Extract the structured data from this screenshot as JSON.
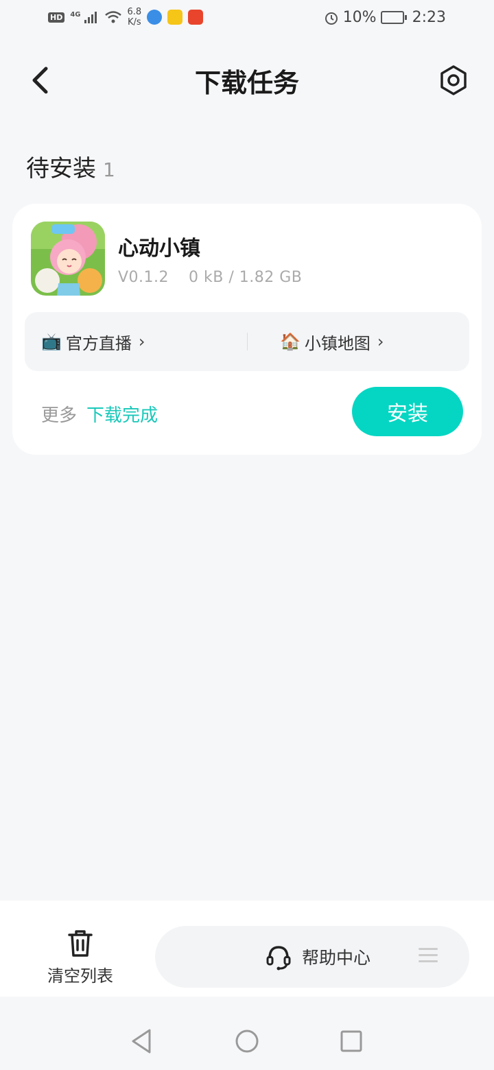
{
  "status_bar": {
    "hd": "HD",
    "network": "4G",
    "speed_value": "6.8",
    "speed_unit": "K/s",
    "battery": "10%",
    "time": "2:23"
  },
  "header": {
    "title": "下载任务",
    "back_icon": "back-arrow-icon",
    "settings_icon": "settings-icon"
  },
  "section": {
    "label": "待安装",
    "count": "1"
  },
  "task": {
    "app_name": "心动小镇",
    "version": "V0.1.2",
    "size": "0 kB / 1.82 GB",
    "links": [
      {
        "emoji": "📺",
        "label": "官方直播"
      },
      {
        "emoji": "🏠",
        "label": "小镇地图"
      }
    ],
    "more_label": "更多",
    "status": "下载完成",
    "install_label": "安装"
  },
  "bottom": {
    "clear_label": "清空列表",
    "help_label": "帮助中心"
  },
  "colors": {
    "accent": "#05d6c3",
    "status_text": "#19c8b9",
    "background": "#f6f7f9"
  }
}
